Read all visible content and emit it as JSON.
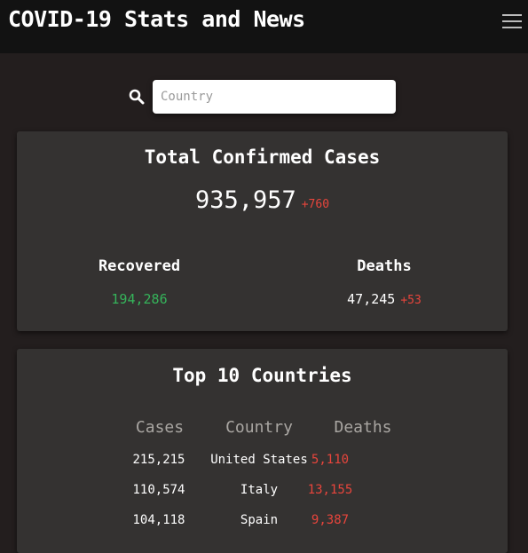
{
  "header": {
    "title": "COVID-19 Stats and News",
    "menu_icon": "hamburger-menu-icon"
  },
  "search": {
    "icon": "search-icon",
    "placeholder": "Country",
    "value": ""
  },
  "totals": {
    "title": "Total Confirmed Cases",
    "confirmed": "935,957",
    "confirmed_delta": "+760",
    "recovered_label": "Recovered",
    "recovered": "194,286",
    "deaths_label": "Deaths",
    "deaths": "47,245",
    "deaths_delta": "+53"
  },
  "top_countries": {
    "title": "Top 10 Countries",
    "columns": [
      "Cases",
      "Country",
      "Deaths"
    ],
    "rows": [
      {
        "cases": "215,215",
        "country": "United States",
        "deaths": "5,110"
      },
      {
        "cases": "110,574",
        "country": "Italy",
        "deaths": "13,155"
      },
      {
        "cases": "104,118",
        "country": "Spain",
        "deaths": "9,387"
      }
    ]
  },
  "colors": {
    "background": "#231e1e",
    "header": "#121212",
    "card": "#343231",
    "increase": "#e8453c",
    "recovered": "#35b35a",
    "column_header": "#a9a6a2"
  }
}
